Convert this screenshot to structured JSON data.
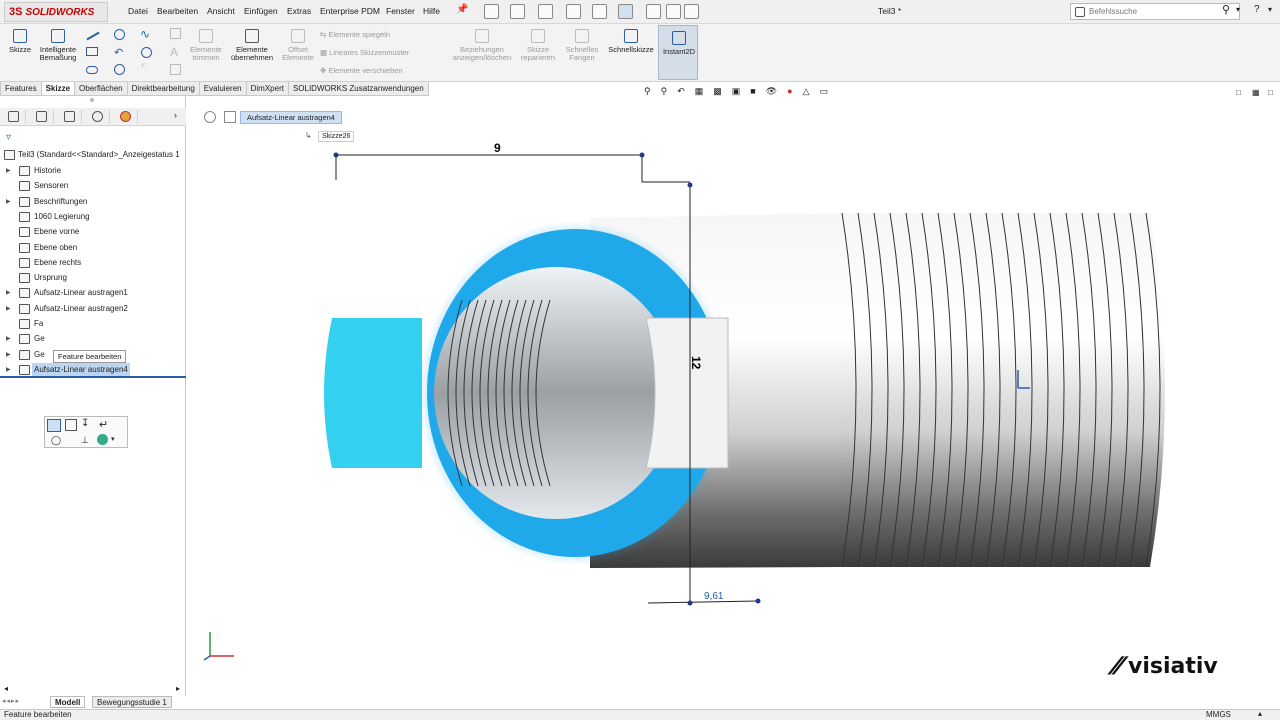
{
  "app": {
    "logo_prefix": "3S",
    "logo_name": "SOLIDWORKS",
    "document_title": "Teil3 *"
  },
  "menu": [
    "Datei",
    "Bearbeiten",
    "Ansicht",
    "Einfügen",
    "Extras",
    "Enterprise PDM",
    "Fenster",
    "Hilfe"
  ],
  "search": {
    "placeholder": "Befehlssuche"
  },
  "ribbon": {
    "skizze": "Skizze",
    "bemassung": "Intelligente Bemaßung",
    "elemente_trimmen": "Elemente trimmen",
    "elemente_uebernehmen": "Elemente übernehmen",
    "offset": "Offset Elemente",
    "spiegeln": "Elemente spiegeln",
    "muster": "Lineares Skizzenmuster",
    "verschieben": "Elemente verschieben",
    "beziehungen": "Beziehungen anzeigen/löschen",
    "reparieren": "Skizze reparieren",
    "fangen": "Schnelles Fangen",
    "schnellskizze": "Schnellskizze",
    "instant2d": "Instant2D"
  },
  "tabs": [
    "Features",
    "Skizze",
    "Oberflächen",
    "Direktbearbeitung",
    "Evaluieren",
    "DimXpert",
    "SOLIDWORKS Zusatzanwendungen"
  ],
  "active_tab": "Skizze",
  "tree": {
    "root": "Teil3  (Standard<<Standard>_Anzeigestatus 1",
    "items": [
      {
        "label": "Historie",
        "arrow": true
      },
      {
        "label": "Sensoren",
        "arrow": false
      },
      {
        "label": "Beschriftungen",
        "arrow": true
      },
      {
        "label": "1060 Legierung",
        "arrow": false
      },
      {
        "label": "Ebene vorne",
        "arrow": false
      },
      {
        "label": "Ebene oben",
        "arrow": false
      },
      {
        "label": "Ebene rechts",
        "arrow": false
      },
      {
        "label": "Ursprung",
        "arrow": false
      },
      {
        "label": "Aufsatz-Linear austragen1",
        "arrow": true
      },
      {
        "label": "Aufsatz-Linear austragen2",
        "arrow": true
      },
      {
        "label": "Fa",
        "arrow": false
      },
      {
        "label": "Ge",
        "arrow": true
      },
      {
        "label": "Ge",
        "arrow": true
      },
      {
        "label": "Aufsatz-Linear austragen4",
        "arrow": true,
        "selected": true
      }
    ]
  },
  "tooltip": "Feature bearbeiten",
  "breadcrumb": {
    "feature": "Aufsatz-Linear austragen4",
    "sketch": "Skizze26"
  },
  "dimensions": {
    "horizontal": "9",
    "vertical": "12",
    "bottom": "9,61"
  },
  "bottom_tabs": [
    "Modell",
    "Bewegungsstudie 1"
  ],
  "status": {
    "left": "Feature bearbeiten",
    "units": "MMGS"
  },
  "brand": "visiativ",
  "colors": {
    "highlight": "#1fa9ea",
    "accent": "#c00000",
    "selection": "#bcd6f2"
  }
}
